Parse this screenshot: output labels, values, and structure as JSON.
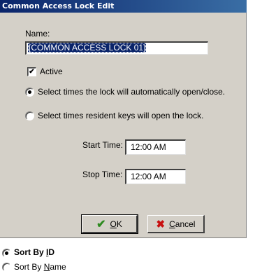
{
  "dialog": {
    "title": "Common Access Lock Edit",
    "name_label": "Name:",
    "name_value": "[COMMON ACCESS LOCK 01]",
    "active_label": "Active",
    "active_checked": true,
    "radio_auto_label": "Select times the lock will automatically open/close.",
    "radio_keys_label": "Select times resident keys will open the lock.",
    "start_time_label": "Start Time:",
    "start_time_value": "12:00 AM",
    "stop_time_label": "Stop Time:",
    "stop_time_value": "12:00 AM",
    "ok_label_mnemonic": "O",
    "ok_label_rest": "K",
    "cancel_label_mnemonic": "C",
    "cancel_label_rest": "ancel"
  },
  "sort": {
    "by_id_prefix": "Sort By ",
    "by_id_mnemonic": "I",
    "by_id_rest": "D",
    "by_name_prefix": "Sort By ",
    "by_name_mnemonic": "N",
    "by_name_rest": "ame"
  }
}
